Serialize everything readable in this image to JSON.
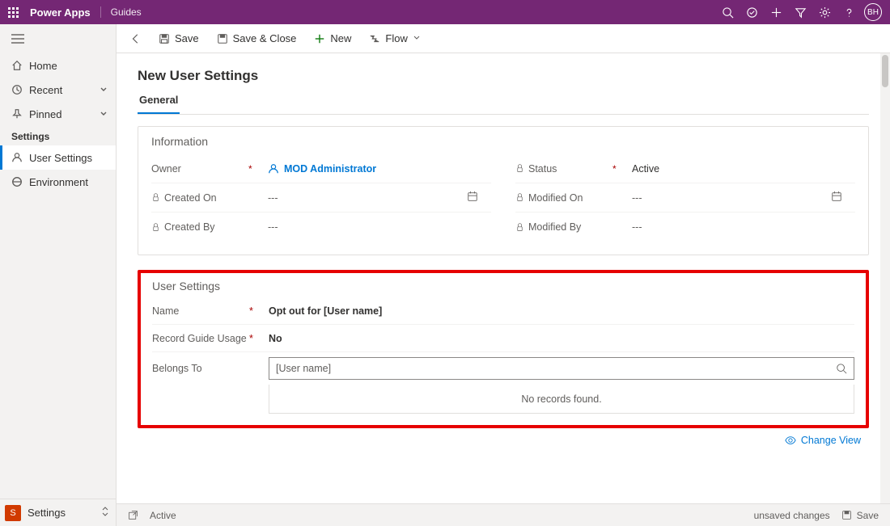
{
  "header": {
    "brand": "Power Apps",
    "subbrand": "Guides",
    "avatar": "BH"
  },
  "sidebar": {
    "home": "Home",
    "recent": "Recent",
    "pinned": "Pinned",
    "section": "Settings",
    "user_settings": "User Settings",
    "environment": "Environment",
    "bottom_letter": "S",
    "bottom_label": "Settings"
  },
  "commands": {
    "save": "Save",
    "save_close": "Save & Close",
    "new": "New",
    "flow": "Flow"
  },
  "page": {
    "title": "New User Settings",
    "tab_general": "General"
  },
  "info_section": {
    "title": "Information",
    "owner_label": "Owner",
    "owner_value": "MOD Administrator",
    "status_label": "Status",
    "status_value": "Active",
    "created_on_label": "Created On",
    "created_on_value": "---",
    "modified_on_label": "Modified On",
    "modified_on_value": "---",
    "created_by_label": "Created By",
    "created_by_value": "---",
    "modified_by_label": "Modified By",
    "modified_by_value": "---"
  },
  "user_settings_section": {
    "title": "User Settings",
    "name_label": "Name",
    "name_value": "Opt out for [User name]",
    "record_label": "Record Guide Usage",
    "record_value": "No",
    "belongs_label": "Belongs To",
    "belongs_placeholder": "[User name]",
    "no_records": "No records found.",
    "change_view": "Change View"
  },
  "status": {
    "active": "Active",
    "unsaved": "unsaved changes",
    "save": "Save"
  }
}
